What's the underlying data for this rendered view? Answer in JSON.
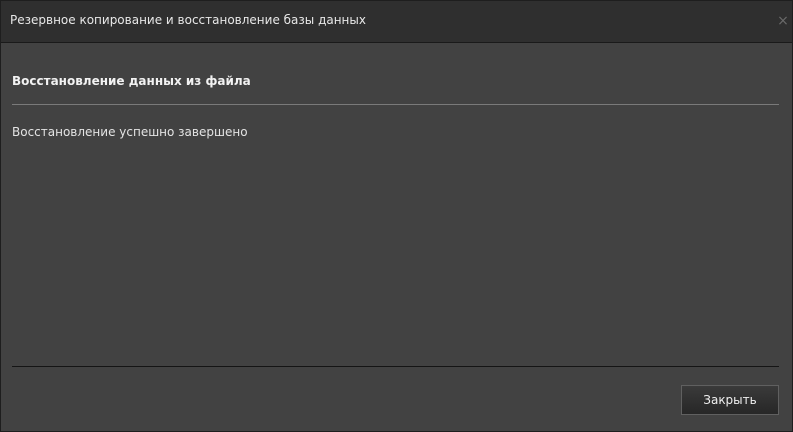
{
  "window": {
    "title": "Резервное копирование и восстановление базы данных",
    "close_icon": "×"
  },
  "content": {
    "heading": "Восстановление данных из файла",
    "message": "Восстановление успешно завершено"
  },
  "footer": {
    "close_label": "Закрыть"
  },
  "colors": {
    "background": "#424242",
    "titlebar": "#2f2f2f",
    "text": "#e8e8e8"
  }
}
